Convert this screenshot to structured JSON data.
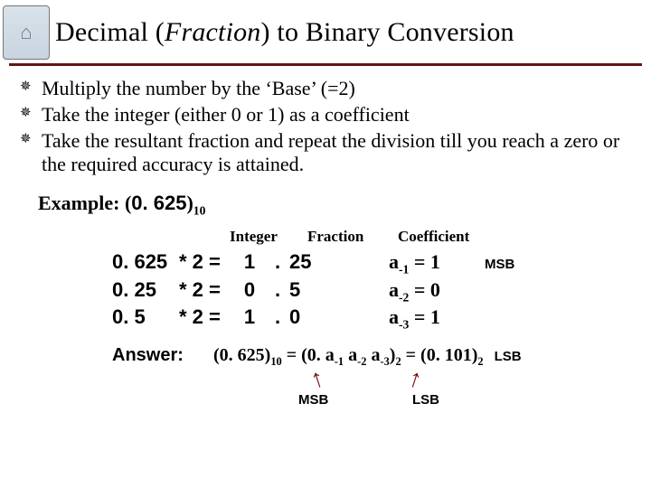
{
  "title": {
    "pre": "Decimal (",
    "italic": "Fraction",
    "post": ") to Binary Conversion"
  },
  "bullets": [
    "Multiply the number by the ‘Base’ (=2)",
    "Take the integer (either 0 or 1) as a coefficient",
    "Take the resultant fraction and repeat the division till you reach a zero or the required accuracy is attained."
  ],
  "example": {
    "label": "Example: (",
    "num": "0. 625",
    "close": ")",
    "sub": "10"
  },
  "headers": {
    "integer": "Integer",
    "fraction": "Fraction",
    "coefficient": "Coefficient"
  },
  "rows": [
    {
      "num": "0. 625",
      "op": "* 2 =",
      "int": "1",
      "dot": ".",
      "frac": "25",
      "coef_a": "a",
      "coef_sub": "-1",
      "coef_eq": " = 1",
      "side": "MSB"
    },
    {
      "num": "0. 25",
      "op": "* 2 =",
      "int": "0",
      "dot": ".",
      "frac": "5",
      "coef_a": "a",
      "coef_sub": "-2",
      "coef_eq": " = 0",
      "side": ""
    },
    {
      "num": "0. 5",
      "op": "* 2 =",
      "int": "1",
      "dot": ".",
      "frac": "0",
      "coef_a": "a",
      "coef_sub": "-3",
      "coef_eq": " = 1",
      "side": ""
    }
  ],
  "answer": {
    "label": "Answer:",
    "p1": "(0. 625)",
    "s1": "10",
    "p2": " = (0. a",
    "s2": "-1",
    "p3": " a",
    "s3": "-2",
    "p4": " a",
    "s4": "-3",
    "p5": ")",
    "s5": "2",
    "p6": " = (0. 101)",
    "s6": "2",
    "lsb": "LSB"
  },
  "arrow_labels": {
    "msb": "MSB",
    "lsb": "LSB"
  }
}
